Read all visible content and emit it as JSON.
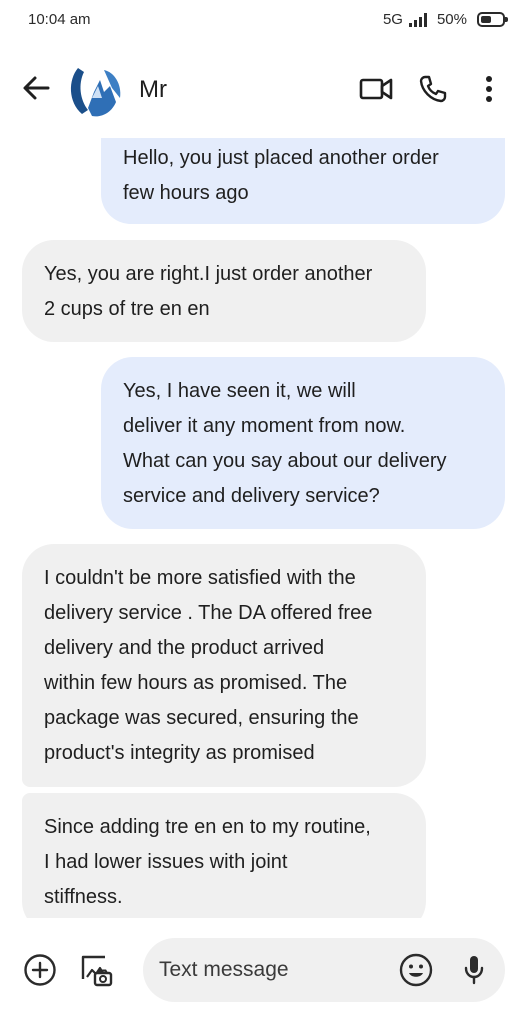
{
  "status_bar": {
    "time": "10:04 am",
    "network": "5G",
    "battery": "50%"
  },
  "header": {
    "contact_name": "Mr",
    "back_icon": "arrow-left-icon",
    "video_icon": "video-camera-icon",
    "call_icon": "phone-icon",
    "more_icon": "more-vert-icon"
  },
  "messages": [
    {
      "direction": "sent",
      "lines": [
        "Hello, you just placed another order",
        "few hours ago"
      ]
    },
    {
      "direction": "received",
      "lines": [
        "Yes, you are right.I just order another",
        "2 cups of tre en en"
      ]
    },
    {
      "direction": "sent",
      "lines": [
        "Yes, I have seen it, we will",
        "deliver it any moment from now.",
        "What can you say about our delivery",
        "service and delivery service?"
      ]
    },
    {
      "direction": "received",
      "lines": [
        "I couldn't be more satisfied with the",
        "delivery service . The DA offered free",
        "delivery and the product arrived",
        "within few hours as promised. The",
        "package was secured, ensuring the",
        "product's integrity as promised"
      ]
    },
    {
      "direction": "received",
      "lines": [
        "Since adding tre en en to my routine,",
        "I had lower issues with joint",
        "stiffness."
      ]
    }
  ],
  "composer": {
    "placeholder": "Text message",
    "add_icon": "add-circle-icon",
    "gallery_icon": "gallery-icon",
    "emoji_icon": "emoji-icon",
    "mic_icon": "mic-icon"
  },
  "colors": {
    "sent_bubble": "#e4ecfc",
    "received_bubble": "#f0f0f0",
    "input_bg": "#f0f0f0",
    "icon": "#2b2b2b"
  }
}
